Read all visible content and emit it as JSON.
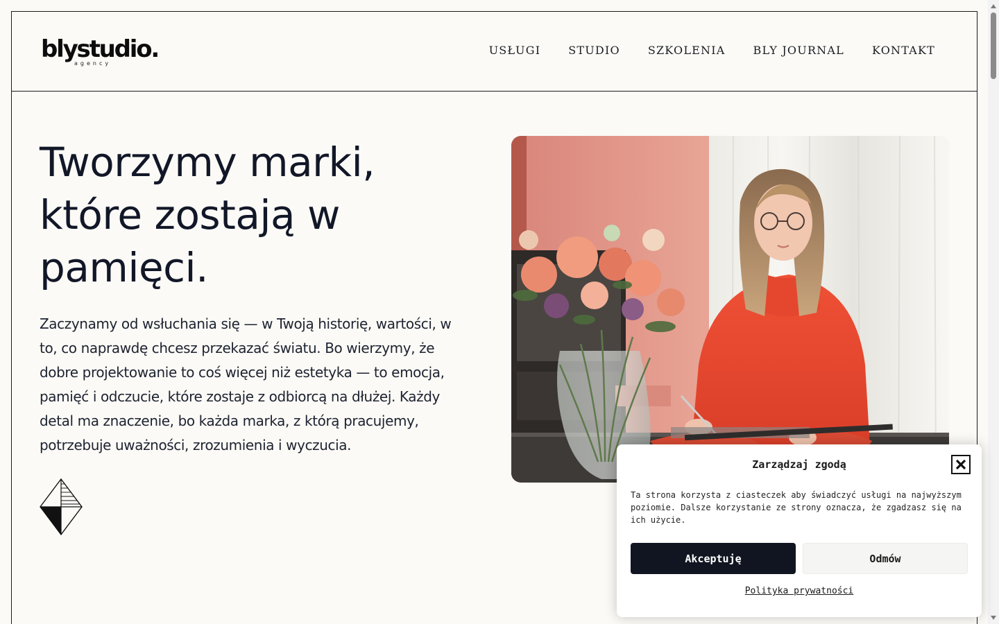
{
  "header": {
    "logo_text": "blystudio.",
    "logo_sub": "agency",
    "nav": [
      {
        "label": "USŁUGI"
      },
      {
        "label": "STUDIO"
      },
      {
        "label": "SZKOLENIA"
      },
      {
        "label": "BLY JOURNAL"
      },
      {
        "label": "KONTAKT"
      }
    ]
  },
  "hero": {
    "title": "Tworzymy marki, które zostają w pamięci.",
    "paragraph": "Zaczynamy od wsłuchania się — w Twoją historię, wartości, w to, co naprawdę chcesz przekazać światu. Bo wierzymy, że dobre projektowanie to coś więcej niż estetyka — to emocja, pamięć i odczucie, które zostaje z odbiorcą na dłużej. Każdy detal ma znaczenie, bo każda marka, z którą pracujemy, potrzebuje uważności, zrozumienia i wyczucia.",
    "image_icon": "woman-with-flowers-photo",
    "decor_icon": "diamond-icon"
  },
  "consent": {
    "title": "Zarządzaj zgodą",
    "text": "Ta strona korzysta z ciasteczek aby świadczyć usługi na najwyższym poziomie. Dalsze korzystanie ze strony oznacza, że zgadzasz się na ich użycie.",
    "accept_label": "Akceptuję",
    "deny_label": "Odmów",
    "privacy_label": "Polityka prywatności"
  },
  "colors": {
    "background": "#fbfaf6",
    "text": "#121728",
    "accent_button": "#101521",
    "sweater": "#e8452f"
  }
}
